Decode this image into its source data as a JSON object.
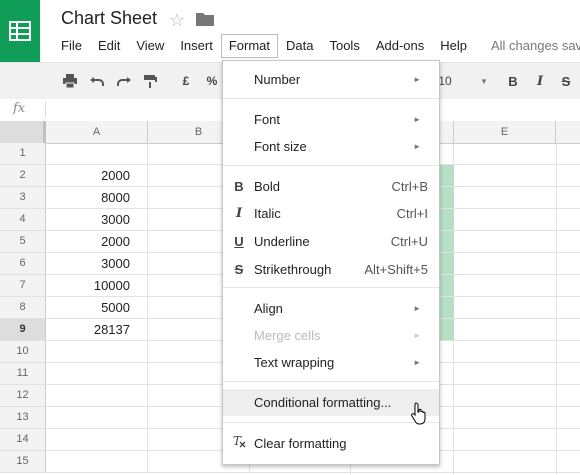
{
  "header": {
    "title": "Chart Sheet",
    "saved_status": "All changes sav"
  },
  "menubar": [
    "File",
    "Edit",
    "View",
    "Insert",
    "Format",
    "Data",
    "Tools",
    "Add-ons",
    "Help"
  ],
  "toolbar": {
    "currency": "£",
    "percent": "%",
    "font_size": "10",
    "bold": "B",
    "italic": "I",
    "strike": "S"
  },
  "formula_bar": {
    "fx_label": "fx",
    "value": ""
  },
  "grid": {
    "columns": [
      "A",
      "B",
      "",
      "",
      "E"
    ],
    "rows": [
      {
        "n": "1",
        "a": ""
      },
      {
        "n": "2",
        "a": "2000"
      },
      {
        "n": "3",
        "a": "8000"
      },
      {
        "n": "4",
        "a": "3000"
      },
      {
        "n": "5",
        "a": "2000"
      },
      {
        "n": "6",
        "a": "3000"
      },
      {
        "n": "7",
        "a": "10000"
      },
      {
        "n": "8",
        "a": "5000"
      },
      {
        "n": "9",
        "a": "28137"
      },
      {
        "n": "10",
        "a": ""
      },
      {
        "n": "11",
        "a": ""
      },
      {
        "n": "12",
        "a": ""
      },
      {
        "n": "13",
        "a": ""
      },
      {
        "n": "14",
        "a": ""
      },
      {
        "n": "15",
        "a": ""
      }
    ]
  },
  "format_menu": {
    "number": "Number",
    "font": "Font",
    "font_size": "Font size",
    "bold": "Bold",
    "bold_shortcut": "Ctrl+B",
    "italic": "Italic",
    "italic_shortcut": "Ctrl+I",
    "underline": "Underline",
    "underline_shortcut": "Ctrl+U",
    "strikethrough": "Strikethrough",
    "strikethrough_shortcut": "Alt+Shift+5",
    "align": "Align",
    "merge_cells": "Merge cells",
    "text_wrapping": "Text wrapping",
    "conditional_formatting": "Conditional formatting...",
    "clear_formatting": "Clear formatting",
    "arrow": "►",
    "bold_icon": "B",
    "italic_icon": "I",
    "underline_icon": "U",
    "strike_icon": "S"
  },
  "colors": {
    "brand": "#0f9d58",
    "highlight_column": "#b7dfc4"
  }
}
